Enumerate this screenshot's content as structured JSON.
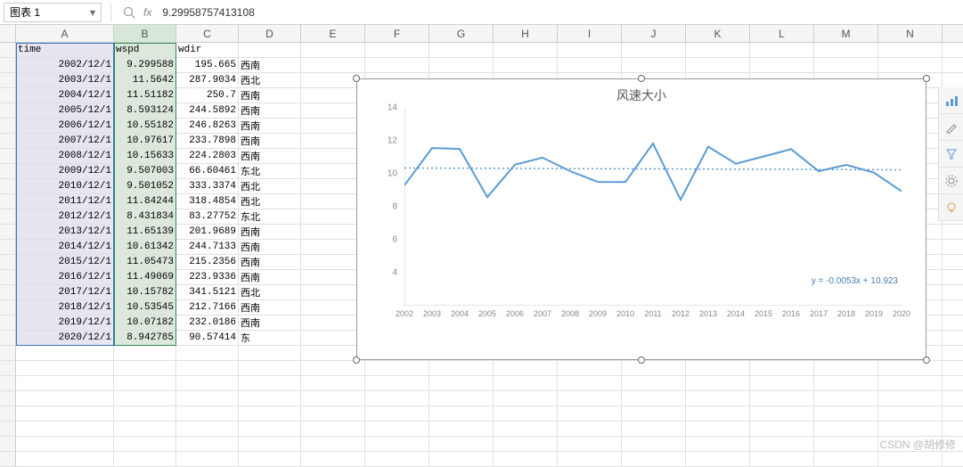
{
  "toolbar": {
    "namebox": "图表 1",
    "formula": "9.29958757413108",
    "fx_label": "fx"
  },
  "columns": [
    "A",
    "B",
    "C",
    "D",
    "E",
    "F",
    "G",
    "H",
    "I",
    "J",
    "K",
    "L",
    "M",
    "N"
  ],
  "headers": {
    "time": "time",
    "wspd": "wspd",
    "wdir": "wdir"
  },
  "rows": [
    {
      "time": "2002/12/1",
      "wspd": "9.299588",
      "wdir": "195.665",
      "dirname": "西南"
    },
    {
      "time": "2003/12/1",
      "wspd": "11.5642",
      "wdir": "287.9034",
      "dirname": "西北"
    },
    {
      "time": "2004/12/1",
      "wspd": "11.51182",
      "wdir": "250.7",
      "dirname": "西南"
    },
    {
      "time": "2005/12/1",
      "wspd": "8.593124",
      "wdir": "244.5892",
      "dirname": "西南"
    },
    {
      "time": "2006/12/1",
      "wspd": "10.55182",
      "wdir": "246.8263",
      "dirname": "西南"
    },
    {
      "time": "2007/12/1",
      "wspd": "10.97617",
      "wdir": "233.7898",
      "dirname": "西南"
    },
    {
      "time": "2008/12/1",
      "wspd": "10.15633",
      "wdir": "224.2803",
      "dirname": "西南"
    },
    {
      "time": "2009/12/1",
      "wspd": "9.507003",
      "wdir": "66.60461",
      "dirname": "东北"
    },
    {
      "time": "2010/12/1",
      "wspd": "9.501052",
      "wdir": "333.3374",
      "dirname": "西北"
    },
    {
      "time": "2011/12/1",
      "wspd": "11.84244",
      "wdir": "318.4854",
      "dirname": "西北"
    },
    {
      "time": "2012/12/1",
      "wspd": "8.431834",
      "wdir": "83.27752",
      "dirname": "东北"
    },
    {
      "time": "2013/12/1",
      "wspd": "11.65139",
      "wdir": "201.9689",
      "dirname": "西南"
    },
    {
      "time": "2014/12/1",
      "wspd": "10.61342",
      "wdir": "244.7133",
      "dirname": "西南"
    },
    {
      "time": "2015/12/1",
      "wspd": "11.05473",
      "wdir": "215.2356",
      "dirname": "西南"
    },
    {
      "time": "2016/12/1",
      "wspd": "11.49069",
      "wdir": "223.9336",
      "dirname": "西南"
    },
    {
      "time": "2017/12/1",
      "wspd": "10.15782",
      "wdir": "341.5121",
      "dirname": "西北"
    },
    {
      "time": "2018/12/1",
      "wspd": "10.53545",
      "wdir": "212.7166",
      "dirname": "西南"
    },
    {
      "time": "2019/12/1",
      "wspd": "10.07182",
      "wdir": "232.0186",
      "dirname": "西南"
    },
    {
      "time": "2020/12/1",
      "wspd": "8.942785",
      "wdir": "90.57414",
      "dirname": "东"
    }
  ],
  "chart_data": {
    "type": "line",
    "title": "风速大小",
    "xlabel": "",
    "ylabel": "",
    "ylim": [
      2,
      14
    ],
    "y_ticks": [
      4,
      6,
      8,
      10,
      12,
      14
    ],
    "x": [
      2002,
      2003,
      2004,
      2005,
      2006,
      2007,
      2008,
      2009,
      2010,
      2011,
      2012,
      2013,
      2014,
      2015,
      2016,
      2017,
      2018,
      2019,
      2020
    ],
    "series": [
      {
        "name": "wspd",
        "values": [
          9.3,
          11.56,
          11.51,
          8.59,
          10.55,
          10.98,
          10.16,
          9.51,
          9.5,
          11.84,
          8.43,
          11.65,
          10.61,
          11.05,
          11.49,
          10.16,
          10.54,
          10.07,
          8.94
        ]
      }
    ],
    "trendline": {
      "equation": "y = -0.0053x + 10.923",
      "type": "linear",
      "dotted": true
    }
  },
  "side_panel": [
    "chart-type",
    "style",
    "filter",
    "settings",
    "idea"
  ],
  "watermark": "CSDN @胡修修"
}
